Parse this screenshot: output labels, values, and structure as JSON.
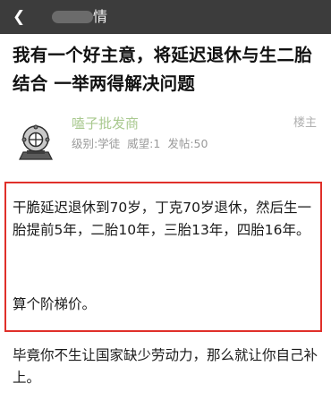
{
  "topbar": {
    "back_icon": "chevron-left-icon",
    "title": "情"
  },
  "post": {
    "title": "我有一个好主意，将延迟退休与生二胎结合 一举两得解决问题"
  },
  "author": {
    "avatar_icon": "diving-helmet-avatar",
    "name": "嗑子批发商",
    "meta": "级别:学徒 威望:1 发帖:50",
    "floor": "楼主"
  },
  "content": {
    "paragraph_1": "干脆延迟退休到70岁，丁克70岁退休，然后生一胎提前5年，二胎10年，三胎13年，四胎16年。",
    "paragraph_2": "算个阶梯价。",
    "paragraph_3": "毕竟你不生让国家缺少劳动力，那么就让你自己补上。"
  },
  "colors": {
    "highlight_border": "#e0302a",
    "author_name": "#a9c98f",
    "topbar_bg": "#3c3c3c"
  }
}
